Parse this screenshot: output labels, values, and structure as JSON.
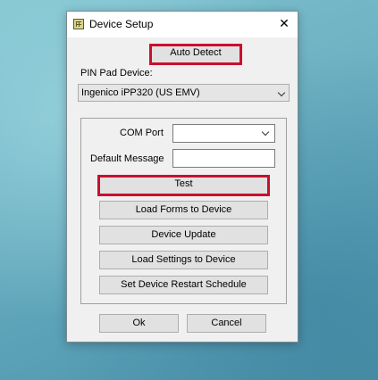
{
  "window": {
    "title": "Device Setup",
    "close_glyph": "✕"
  },
  "buttons": {
    "auto_detect": "Auto Detect",
    "test": "Test",
    "load_forms": "Load Forms to Device",
    "device_update": "Device Update",
    "load_settings": "Load Settings to Device",
    "restart_schedule": "Set Device Restart Schedule",
    "ok": "Ok",
    "cancel": "Cancel"
  },
  "pin_pad": {
    "label": "PIN Pad Device:",
    "selected": "Ingenico iPP320 (US EMV)"
  },
  "com_port": {
    "label": "COM Port",
    "value": ""
  },
  "default_message": {
    "label": "Default Message",
    "value": ""
  },
  "colors": {
    "highlight_border": "#c8102e",
    "dialog_bg": "#f0f0f0",
    "button_bg": "#e1e1e1"
  },
  "icons": {
    "app": "grid-icon",
    "close": "close-icon",
    "dropdown": "chevron-down-icon"
  }
}
